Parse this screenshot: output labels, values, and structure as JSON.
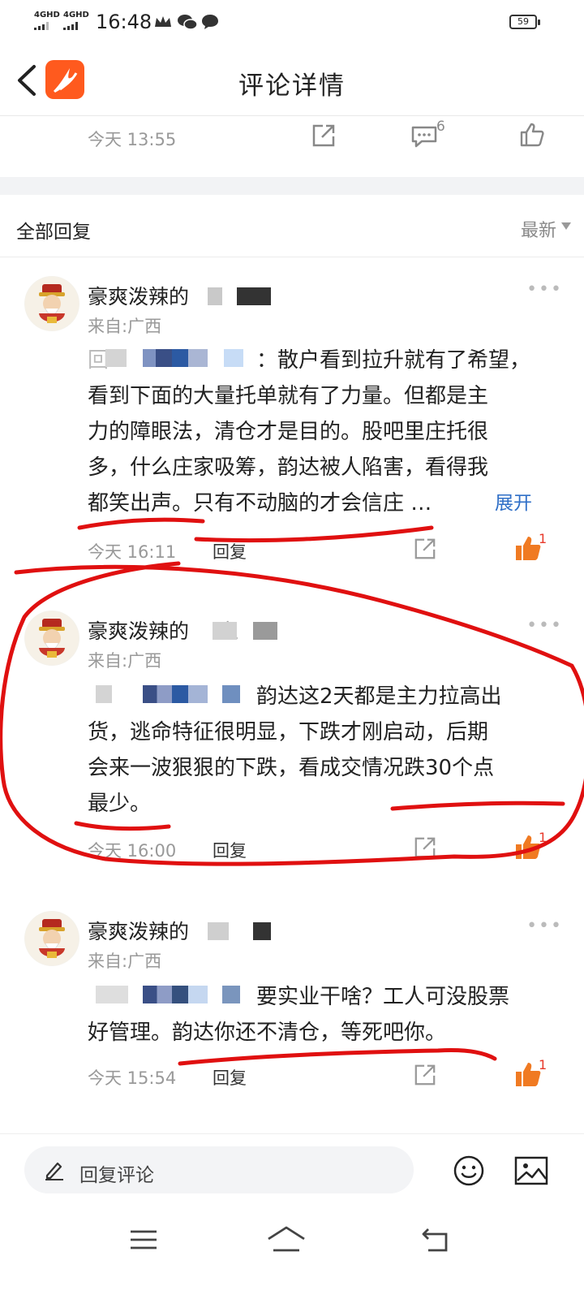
{
  "status_bar": {
    "signal_1": "4GHD",
    "signal_2": "4GHD",
    "time": "16:48",
    "battery": "59"
  },
  "header": {
    "title": "评论详情"
  },
  "parent_comment": {
    "time": "今天 13:55",
    "comment_count": "6"
  },
  "replies_section": {
    "title": "全部回复",
    "sort_label": "最新"
  },
  "comments": [
    {
      "username": "豪爽泼辣的",
      "source": "来自:广西",
      "lines": [
        "回",
        "看到下面的大量托单就有了力量。但都是主",
        "力的障眼法，清仓才是目的。股吧里庄托很",
        "多，什么庄家吸筹，韵达被人陷害，看得我"
      ],
      "line1_tail": "：散户看到拉升就有了希望，",
      "line5": "都笑出声。只有不动脑的才会信庄 …",
      "expand": "展开",
      "time": "今天 16:11",
      "reply": "回复",
      "likes": "1"
    },
    {
      "username": "豪爽泼辣的",
      "username_tail": "之",
      "source": "来自:广西",
      "line1_tail": "韵达这2天都是主力拉高出",
      "lines": [
        "货，逃命特征很明显，下跌才刚启动，后期",
        "会来一波狠狠的下跌，看成交情况跌30个点",
        "最少。"
      ],
      "time": "今天 16:00",
      "reply": "回复",
      "likes": "1"
    },
    {
      "username": "豪爽泼辣的",
      "source": "来自:广西",
      "line1_tail": "要实业干啥？工人可没股票",
      "lines": [
        "好管理。韵达你还不清仓，等死吧你。"
      ],
      "time": "今天 15:54",
      "reply": "回复",
      "likes": "1"
    }
  ],
  "bottom_bar": {
    "reply_placeholder": "回复评论"
  },
  "colors": {
    "accent_orange": "#ff5a1e",
    "like_orange": "#f07a22",
    "link_blue": "#2f6fc7",
    "annotation_red": "#e01010"
  }
}
